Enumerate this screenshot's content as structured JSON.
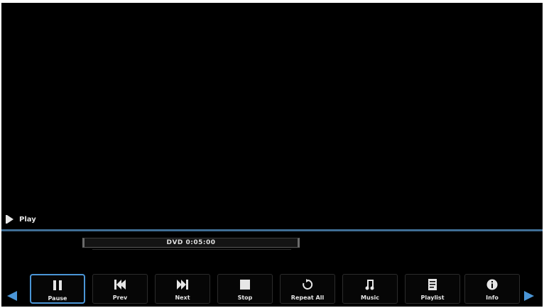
{
  "status": {
    "icon": "play-icon",
    "text": "Play"
  },
  "progress": {
    "text": "DVD 0:05:00"
  },
  "controls": [
    {
      "name": "pause-button",
      "icon": "pause-icon",
      "label": "Pause",
      "selected": true
    },
    {
      "name": "previous-button",
      "icon": "skip-previous-icon",
      "label": "Prev",
      "selected": false
    },
    {
      "name": "next-button",
      "icon": "skip-next-icon",
      "label": "Next",
      "selected": false
    },
    {
      "name": "stop-button",
      "icon": "stop-icon",
      "label": "Stop",
      "selected": false
    },
    {
      "name": "repeat-button",
      "icon": "repeat-icon",
      "label": "Repeat All",
      "selected": false
    },
    {
      "name": "music-button",
      "icon": "music-note-icon",
      "label": "Music",
      "selected": false
    },
    {
      "name": "playlist-button",
      "icon": "playlist-icon",
      "label": "Playlist",
      "selected": false
    },
    {
      "name": "info-button",
      "icon": "info-icon",
      "label": "Info",
      "selected": false
    }
  ],
  "nav": {
    "left_icon": "arrow-left-icon",
    "right_icon": "arrow-right-icon"
  },
  "colors": {
    "accent": "#4a95d6",
    "background": "#000000",
    "divider": "#3f6d94",
    "text": "#e6e6e6"
  }
}
